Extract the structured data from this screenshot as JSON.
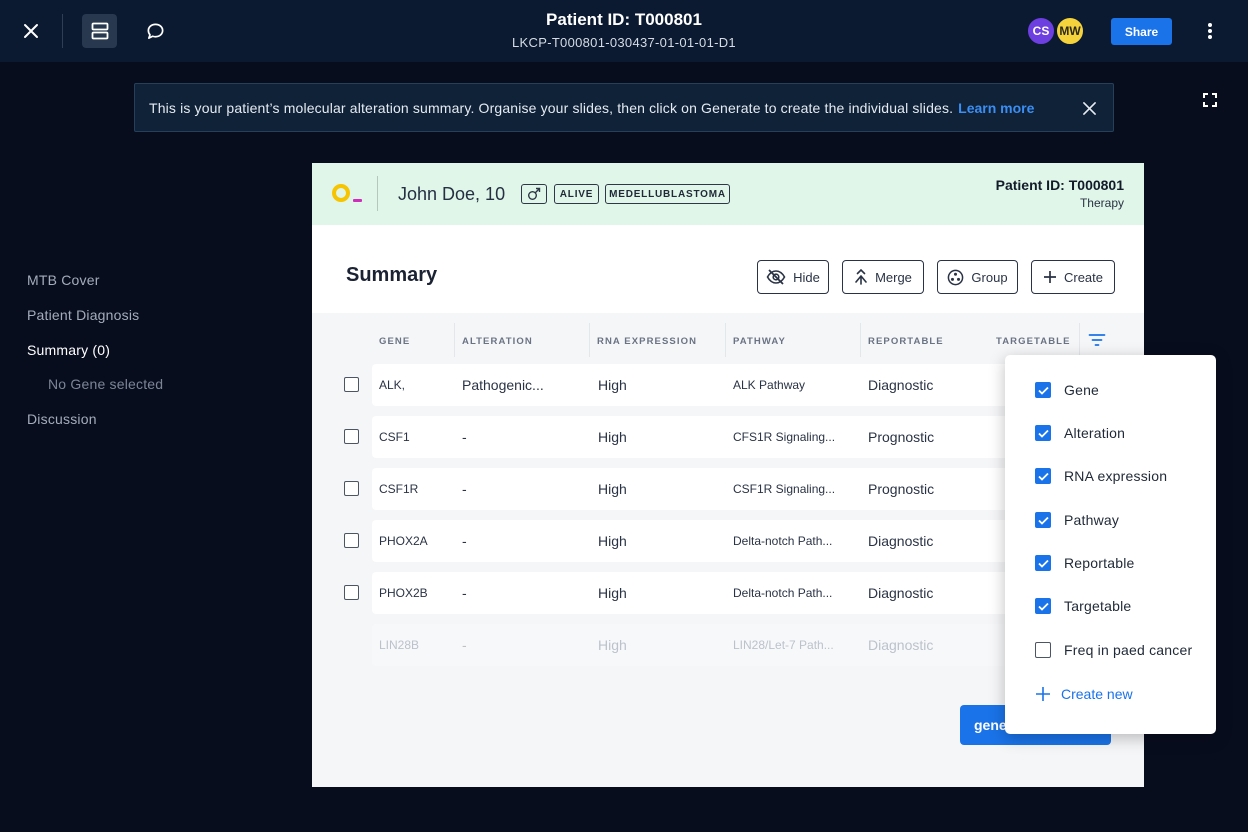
{
  "topbar": {
    "title": "Patient ID: T000801",
    "subtitle": "LKCP-T000801-030437-01-01-01-D1",
    "avatars": [
      "CS",
      "MW"
    ],
    "share_label": "Share"
  },
  "banner": {
    "text": "This is your patient’s molecular alteration summary. Organise your slides, then click on Generate to create the individual slides.",
    "link": "Learn more"
  },
  "nav": {
    "items": [
      "MTB Cover",
      "Patient Diagnosis",
      "Summary (0)",
      "Discussion"
    ],
    "sub": "No Gene selected"
  },
  "slide": {
    "patient_name": "John Doe, 10",
    "status": "ALIVE",
    "diagnosis": "MEDELLUBLASTOMA",
    "patient_id": "Patient ID: T000801",
    "section": "Therapy",
    "summary_title": "Summary",
    "actions": {
      "hide": "Hide",
      "merge": "Merge",
      "group": "Group",
      "create": "Create"
    },
    "columns": [
      "GENE",
      "ALTERATION",
      "RNA EXPRESSION",
      "PATHWAY",
      "REPORTABLE",
      "TARGETABLE"
    ],
    "rows": [
      {
        "gene": "ALK,",
        "alteration": "Pathogenic...",
        "rna": "High",
        "pathway": "ALK Pathway",
        "reportable": "Diagnostic"
      },
      {
        "gene": "CSF1",
        "alteration": "-",
        "rna": "High",
        "pathway": "CFS1R Signaling...",
        "reportable": "Prognostic"
      },
      {
        "gene": "CSF1R",
        "alteration": "-",
        "rna": "High",
        "pathway": "CSF1R Signaling...",
        "reportable": "Prognostic"
      },
      {
        "gene": "PHOX2A",
        "alteration": "-",
        "rna": "High",
        "pathway": "Delta-notch Path...",
        "reportable": "Diagnostic"
      },
      {
        "gene": "PHOX2B",
        "alteration": "-",
        "rna": "High",
        "pathway": "Delta-notch Path...",
        "reportable": "Diagnostic"
      },
      {
        "gene": "LIN28B",
        "alteration": "-",
        "rna": "High",
        "pathway": "LIN28/Let-7 Path...",
        "reportable": "Diagnostic"
      }
    ],
    "generate_label": "gene"
  },
  "column_menu": {
    "options": [
      {
        "label": "Gene",
        "checked": true
      },
      {
        "label": "Alteration",
        "checked": true
      },
      {
        "label": "RNA expression",
        "checked": true
      },
      {
        "label": "Pathway",
        "checked": true
      },
      {
        "label": "Reportable",
        "checked": true
      },
      {
        "label": "Targetable",
        "checked": true
      },
      {
        "label": "Freq in paed cancer",
        "checked": false
      }
    ],
    "create_label": "Create new"
  },
  "colors": {
    "accent": "#1a73e8",
    "topbar": "#0b1a30",
    "background": "#080d1e",
    "slide_header": "#e0f6e8"
  }
}
